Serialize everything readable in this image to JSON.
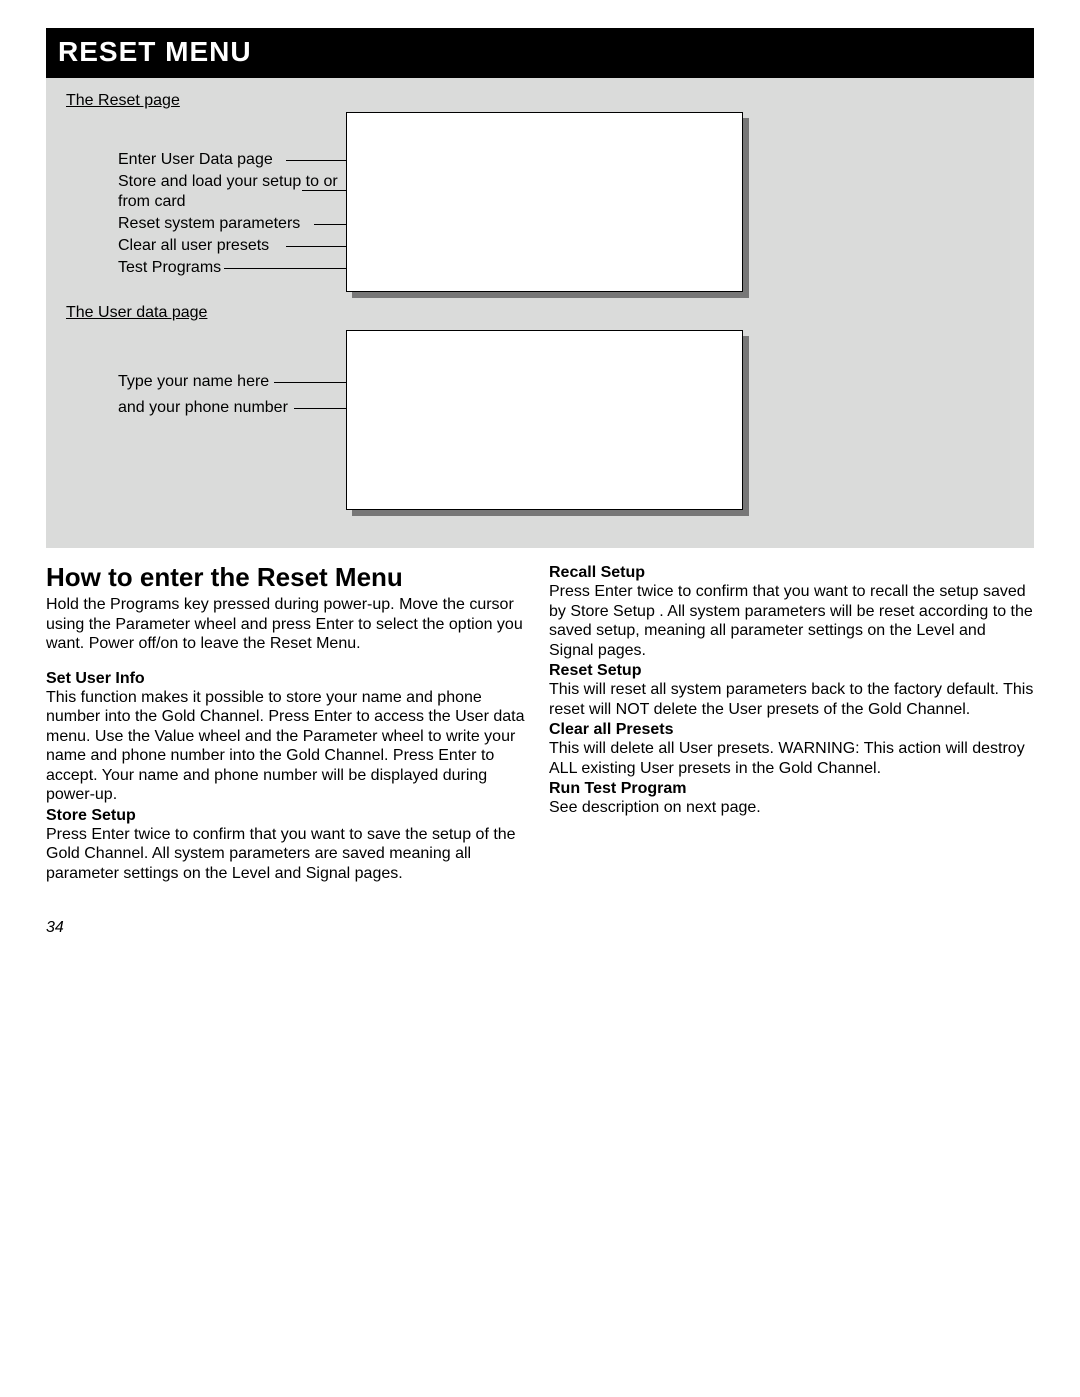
{
  "title": "Reset Menu",
  "diagram": {
    "reset_page_label": "The Reset page",
    "user_data_label": "The User data page",
    "callouts_top": [
      "Enter User Data page",
      "Store and load your setup to or from card",
      "Reset system parameters",
      "Clear all user presets",
      "Test Programs"
    ],
    "callouts_bottom": [
      "Type your name here",
      "and your phone number"
    ]
  },
  "heading": "How to enter the Reset Menu",
  "left": {
    "intro": "Hold the Programs key pressed during power-up. Move the cursor using the Parameter wheel and press Enter to select  the option you want.  Power off/on to leave the Reset Menu.",
    "set_user_info_h": "Set User Info",
    "set_user_info": "This function makes it possible to store your name and phone number into the Gold Channel. Press Enter to access the User data menu. Use the Value wheel and the Parameter wheel to write your name and phone number into the Gold Channel. Press Enter to accept. Your name and phone number will be displayed during power-up.",
    "store_setup_h": "Store Setup",
    "store_setup": "Press Enter twice to confirm that you want to save the setup of the Gold Channel. All system parameters are saved meaning all parameter settings on the Level and Signal pages."
  },
  "right": {
    "recall_setup_h": "Recall Setup",
    "recall_setup": "Press Enter twice to confirm that you want to recall the setup saved by  Store Setup . All system parameters will be reset according to the saved setup, meaning all parameter settings on the Level and Signal pages.",
    "reset_setup_h": "Reset Setup",
    "reset_setup": "This will reset all system parameters back to the factory default. This reset will NOT delete the User presets of the Gold Channel.",
    "clear_presets_h": "Clear all Presets",
    "clear_presets": "This will delete all User presets. WARNING: This action will destroy ALL existing User presets in the Gold Channel.",
    "run_test_h": "Run Test Program",
    "run_test": "See description on next page."
  },
  "page_number": "34"
}
